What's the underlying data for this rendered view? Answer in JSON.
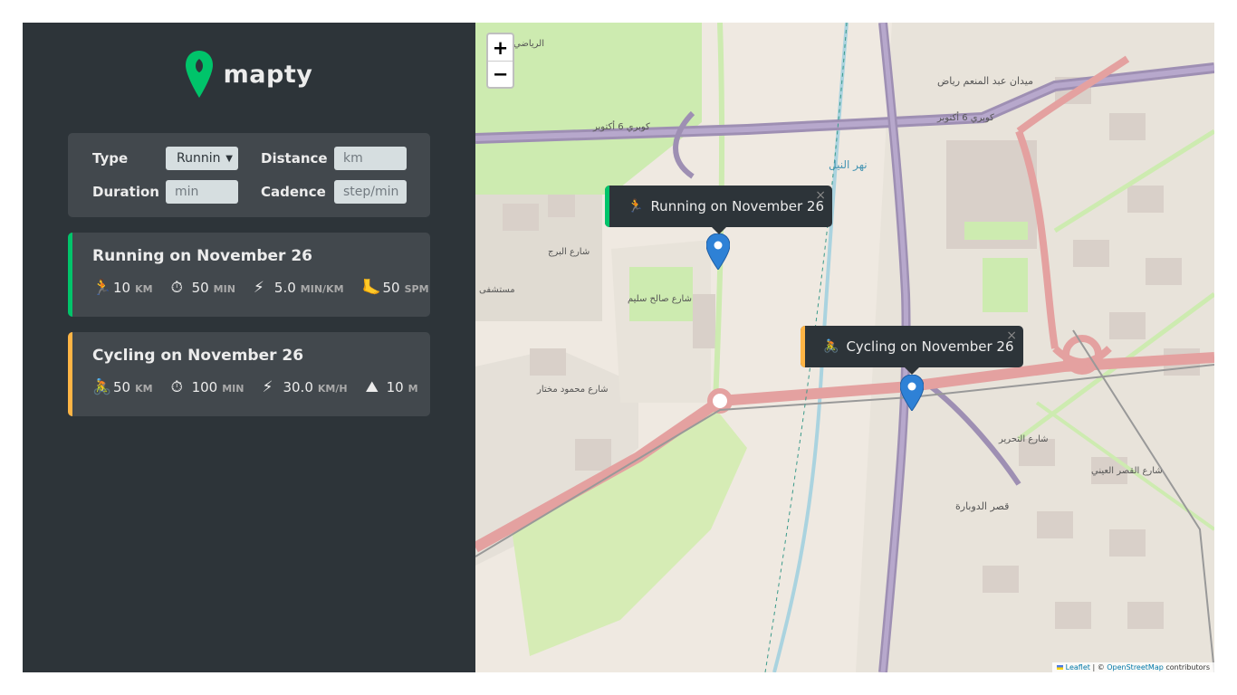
{
  "app": {
    "logo_text": "mapty"
  },
  "form": {
    "type_label": "Type",
    "type_value": "Running",
    "distance_label": "Distance",
    "distance_placeholder": "km",
    "duration_label": "Duration",
    "duration_placeholder": "min",
    "cadence_label": "Cadence",
    "cadence_placeholder": "step/min"
  },
  "workouts": [
    {
      "kind": "running",
      "title": "Running on November 26",
      "details": [
        {
          "icon": "runner-icon",
          "glyph": "🏃",
          "value": "10",
          "unit": "KM"
        },
        {
          "icon": "stopwatch-icon",
          "glyph": "⏱",
          "value": "50",
          "unit": "MIN"
        },
        {
          "icon": "lightning-icon",
          "glyph": "⚡",
          "value": "5.0",
          "unit": "MIN/KM"
        },
        {
          "icon": "foot-icon",
          "glyph": "🦶",
          "value": "50",
          "unit": "SPM"
        }
      ]
    },
    {
      "kind": "cycling",
      "title": "Cycling on November 26",
      "details": [
        {
          "icon": "cyclist-icon",
          "glyph": "🚴",
          "value": "50",
          "unit": "KM"
        },
        {
          "icon": "stopwatch-icon",
          "glyph": "⏱",
          "value": "100",
          "unit": "MIN"
        },
        {
          "icon": "lightning-icon",
          "glyph": "⚡",
          "value": "30.0",
          "unit": "KM/H"
        },
        {
          "icon": "mountain-icon",
          "glyph": "⛰",
          "value": "10",
          "unit": "M"
        }
      ]
    }
  ],
  "map": {
    "zoom_in": "+",
    "zoom_out": "−",
    "popups": [
      {
        "kind": "running",
        "icon_glyph": "🏃",
        "text": "Running on November 26",
        "close": "×"
      },
      {
        "kind": "cycling",
        "icon_glyph": "🚴",
        "text": "Cycling on November 26",
        "close": "×"
      }
    ],
    "attribution": {
      "leaflet": "Leaflet",
      "separator": " | © ",
      "osm": "OpenStreetMap",
      "suffix": " contributors"
    },
    "labels": {
      "bridge_1": "كوبري 6 أكتوبر",
      "bridge_2": "كوبري 6 أكتوبر",
      "square": "ميدان عبد المنعم رياض",
      "nile": "نهر النيل",
      "street_burj": "شارع البرج",
      "street_saleh": "شارع صالح سليم",
      "street_tahrir": "شارع التحرير",
      "mokhtar": "شارع محمود مختار",
      "qasr_dubara": "قصر الدوبارة",
      "hospital": "مستشفى",
      "riyadi": "الرياضي",
      "qasr_aini": "شارع القصر العيني"
    },
    "colors": {
      "land": "#efe9e1",
      "green": "#cdebb0",
      "water": "#aad3df",
      "motorway": "#9e8fb3",
      "primary_road": "#e4a1a0"
    }
  }
}
